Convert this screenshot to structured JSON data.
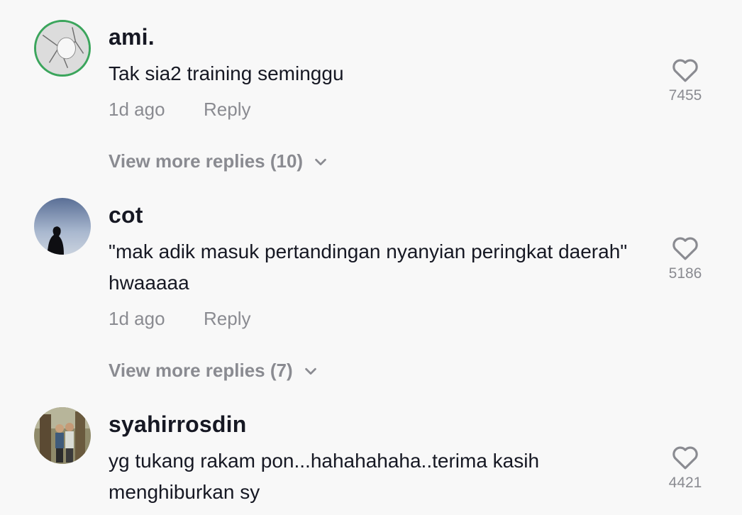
{
  "comments": [
    {
      "username": "ami.",
      "text": "Tak sia2 training seminggu",
      "age": "1d ago",
      "reply_label": "Reply",
      "likes": "7455",
      "view_more": "View more replies (10)"
    },
    {
      "username": "cot",
      "text": "\"mak adik masuk pertandingan nyanyian peringkat daerah\" hwaaaaa",
      "age": "1d ago",
      "reply_label": "Reply",
      "likes": "5186",
      "view_more": "View more replies (7)"
    },
    {
      "username": "syahirrosdin",
      "text": "yg tukang rakam pon...hahahahaha..terima kasih menghiburkan sy",
      "likes": "4421"
    }
  ],
  "icons": {
    "like": "heart-outline-icon",
    "expand": "chevron-down-icon"
  },
  "colors": {
    "background": "#f8f8f8",
    "username": "#161823",
    "muted": "#8a8b91",
    "avatar_ring": "#3ba55c"
  }
}
